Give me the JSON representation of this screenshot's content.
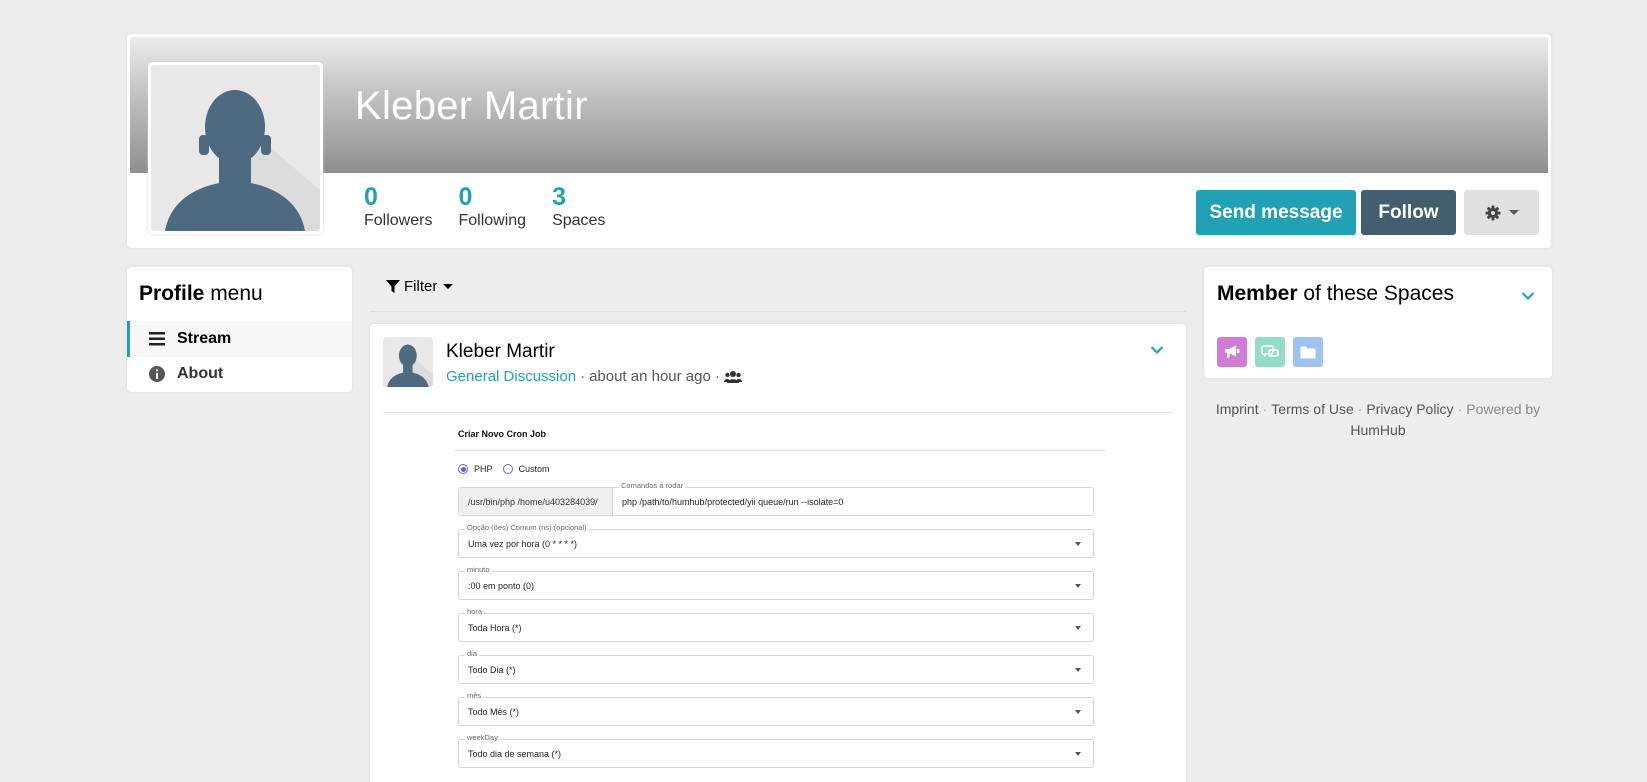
{
  "profile": {
    "name": "Kleber Martir",
    "stats": [
      {
        "value": "0",
        "label": "Followers"
      },
      {
        "value": "0",
        "label": "Following"
      },
      {
        "value": "3",
        "label": "Spaces"
      }
    ],
    "send_message_label": "Send message",
    "follow_label": "Follow"
  },
  "menu": {
    "title_bold": "Profile",
    "title_rest": " menu",
    "items": [
      {
        "label": "Stream",
        "icon": "bars-icon",
        "active": true
      },
      {
        "label": "About",
        "icon": "info-circle-icon",
        "active": false
      }
    ]
  },
  "stream": {
    "filter_label": "Filter",
    "post": {
      "author": "Kleber Martir",
      "space": "General Discussion",
      "time": "about an hour ago",
      "separator": "·",
      "visibility_icon": "users-icon"
    },
    "embed": {
      "title": "Criar Novo Cron Job",
      "radio_php": "PHP",
      "radio_custom": "Custom",
      "cmd_prefix": "/usr/bin/php /home/u403284039/",
      "cmd_label": "Comandos a rodar",
      "cmd_value": "php /path/to/humhub/protected/yii queue/run --isolate=0",
      "selects": [
        {
          "label": "Opção (ões) Comum (ns) (opcional)",
          "value": "Uma vez por hora (0 * * * *)"
        },
        {
          "label": "minuto",
          "value": ":00 em ponto (0)"
        },
        {
          "label": "hora",
          "value": "Toda Hora (*)"
        },
        {
          "label": "dia",
          "value": "Todo Dia (*)"
        },
        {
          "label": "mês",
          "value": "Todo Mês (*)"
        },
        {
          "label": "weekDay",
          "value": "Todo dia de semana (*)"
        }
      ]
    }
  },
  "spaces": {
    "title_bold": "Member",
    "title_rest": " of these Spaces",
    "icons": [
      {
        "name": "megaphone-icon",
        "color": "#d07bd6"
      },
      {
        "name": "chat-icon",
        "color": "#93ddc8"
      },
      {
        "name": "folder-icon",
        "color": "#9fc3ee"
      }
    ]
  },
  "footer": {
    "imprint": "Imprint",
    "terms": "Terms of Use",
    "privacy": "Privacy Policy",
    "powered": "Powered by",
    "humhub": "HumHub",
    "dot": "·"
  },
  "colors": {
    "accent": "#21a1b3",
    "follow": "#435f6f",
    "background": "#ededed"
  }
}
